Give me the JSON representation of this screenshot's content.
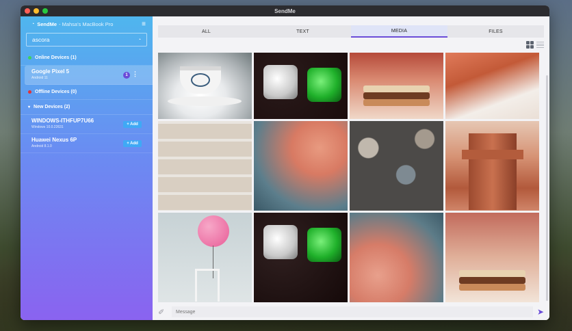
{
  "window": {
    "title": "SendMe"
  },
  "sidebar": {
    "header": {
      "app_name": "SendMe",
      "device_label": "- Mahsa's MacBook Pro"
    },
    "search": {
      "value": "ascora"
    },
    "sections": {
      "online": {
        "label": "Online Devices (1)",
        "color": "#3fd15a"
      },
      "offline": {
        "label": "Offline Devices (0)",
        "color": "#e0323a"
      },
      "new": {
        "label": "New Devices (2)"
      }
    },
    "online_devices": [
      {
        "name": "Google Pixel 5",
        "os": "Android 11",
        "badge": "1"
      }
    ],
    "new_devices": [
      {
        "name": "WINDOWS-ITHFUP7U66",
        "os": "Windows 10.0.22631",
        "add_label": "+ Add"
      },
      {
        "name": "Huawei Nexus 6P",
        "os": "Android 8.1.0",
        "add_label": "+ Add"
      }
    ]
  },
  "tabs": [
    {
      "label": "ALL",
      "active": false
    },
    {
      "label": "TEXT",
      "active": false
    },
    {
      "label": "MEDIA",
      "active": true
    },
    {
      "label": "FILES",
      "active": false
    }
  ],
  "gallery": [
    {
      "subject": "teacup"
    },
    {
      "subject": "dice"
    },
    {
      "subject": "sandwich"
    },
    {
      "subject": "girl"
    },
    {
      "subject": "shoes"
    },
    {
      "subject": "clouds"
    },
    {
      "subject": "pebbles"
    },
    {
      "subject": "tower"
    },
    {
      "subject": "balloon-chair"
    },
    {
      "subject": "dice"
    },
    {
      "subject": "clouds"
    },
    {
      "subject": "sandwich"
    }
  ],
  "message_bar": {
    "placeholder": "Message"
  },
  "colors": {
    "accent": "#6a4cd8",
    "add_button": "#3fa9f5"
  }
}
